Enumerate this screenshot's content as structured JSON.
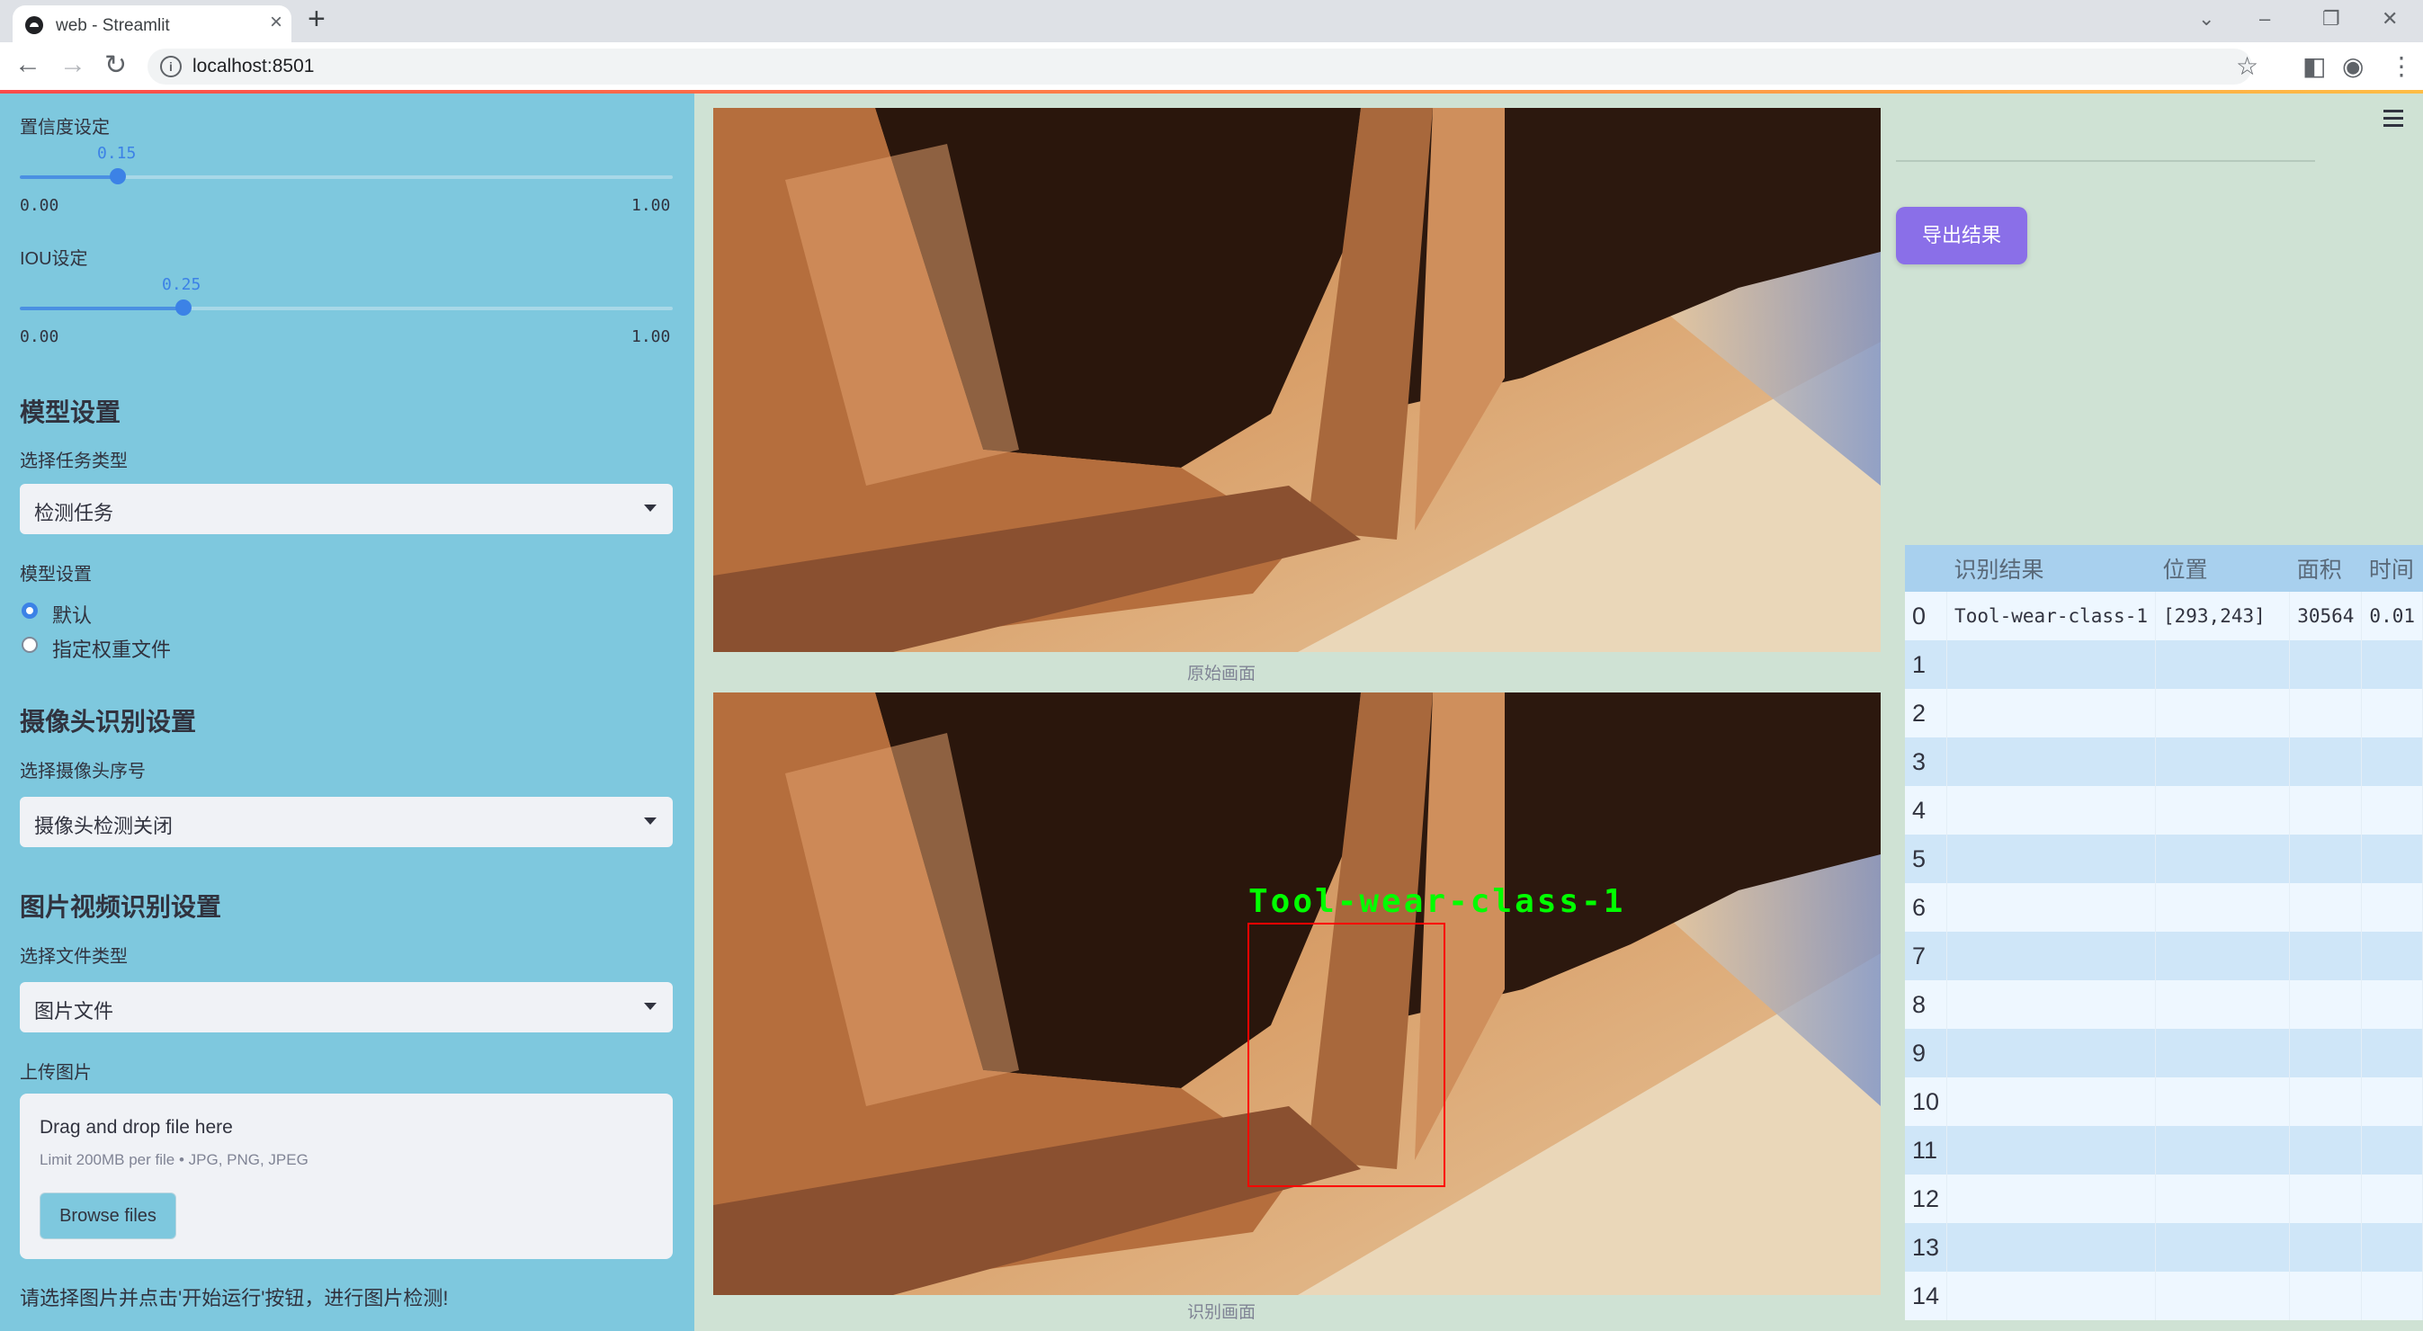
{
  "browser": {
    "tab_title": "web - Streamlit",
    "url": "localhost:8501"
  },
  "sidebar": {
    "confidence": {
      "label": "置信度设定",
      "value": "0.15",
      "value_num": 0.15,
      "min": "0.00",
      "max": "1.00"
    },
    "iou": {
      "label": "IOU设定",
      "value": "0.25",
      "value_num": 0.25,
      "min": "0.00",
      "max": "1.00"
    },
    "model_section": {
      "heading": "模型设置",
      "task_label": "选择任务类型",
      "task_value": "检测任务",
      "model_label": "模型设置",
      "radio_default": "默认",
      "radio_custom": "指定权重文件"
    },
    "camera_section": {
      "heading": "摄像头识别设置",
      "camera_label": "选择摄像头序号",
      "camera_value": "摄像头检测关闭"
    },
    "file_section": {
      "heading": "图片视频识别设置",
      "filetype_label": "选择文件类型",
      "filetype_value": "图片文件",
      "upload_label": "上传图片",
      "upload_title": "Drag and drop file here",
      "upload_limit": "Limit 200MB per file • JPG, PNG, JPEG",
      "browse_label": "Browse files"
    },
    "note": "请选择图片并点击'开始运行'按钮，进行图片检测!"
  },
  "main": {
    "original_caption": "原始画面",
    "result_caption": "识别画面",
    "detection_label": "Tool-wear-class-1"
  },
  "right": {
    "export_label": "导出结果",
    "table": {
      "headers": [
        "",
        "识别结果",
        "位置",
        "面积",
        "时间"
      ],
      "rows": [
        [
          "0",
          "Tool-wear-class-1",
          "[293,243]",
          "30564",
          "0.01"
        ],
        [
          "1",
          "",
          "",
          "",
          ""
        ],
        [
          "2",
          "",
          "",
          "",
          ""
        ],
        [
          "3",
          "",
          "",
          "",
          ""
        ],
        [
          "4",
          "",
          "",
          "",
          ""
        ],
        [
          "5",
          "",
          "",
          "",
          ""
        ],
        [
          "6",
          "",
          "",
          "",
          ""
        ],
        [
          "7",
          "",
          "",
          "",
          ""
        ],
        [
          "8",
          "",
          "",
          "",
          ""
        ],
        [
          "9",
          "",
          "",
          "",
          ""
        ],
        [
          "10",
          "",
          "",
          "",
          ""
        ],
        [
          "11",
          "",
          "",
          "",
          ""
        ],
        [
          "12",
          "",
          "",
          "",
          ""
        ],
        [
          "13",
          "",
          "",
          "",
          ""
        ],
        [
          "14",
          "",
          "",
          "",
          ""
        ]
      ]
    }
  },
  "colors": {
    "sidebar_bg": "#7ec8de",
    "accent": "#3c82e6",
    "export_button": "#8a6fe8",
    "detection_text": "#00ff00",
    "detection_box": "#ff0000"
  }
}
